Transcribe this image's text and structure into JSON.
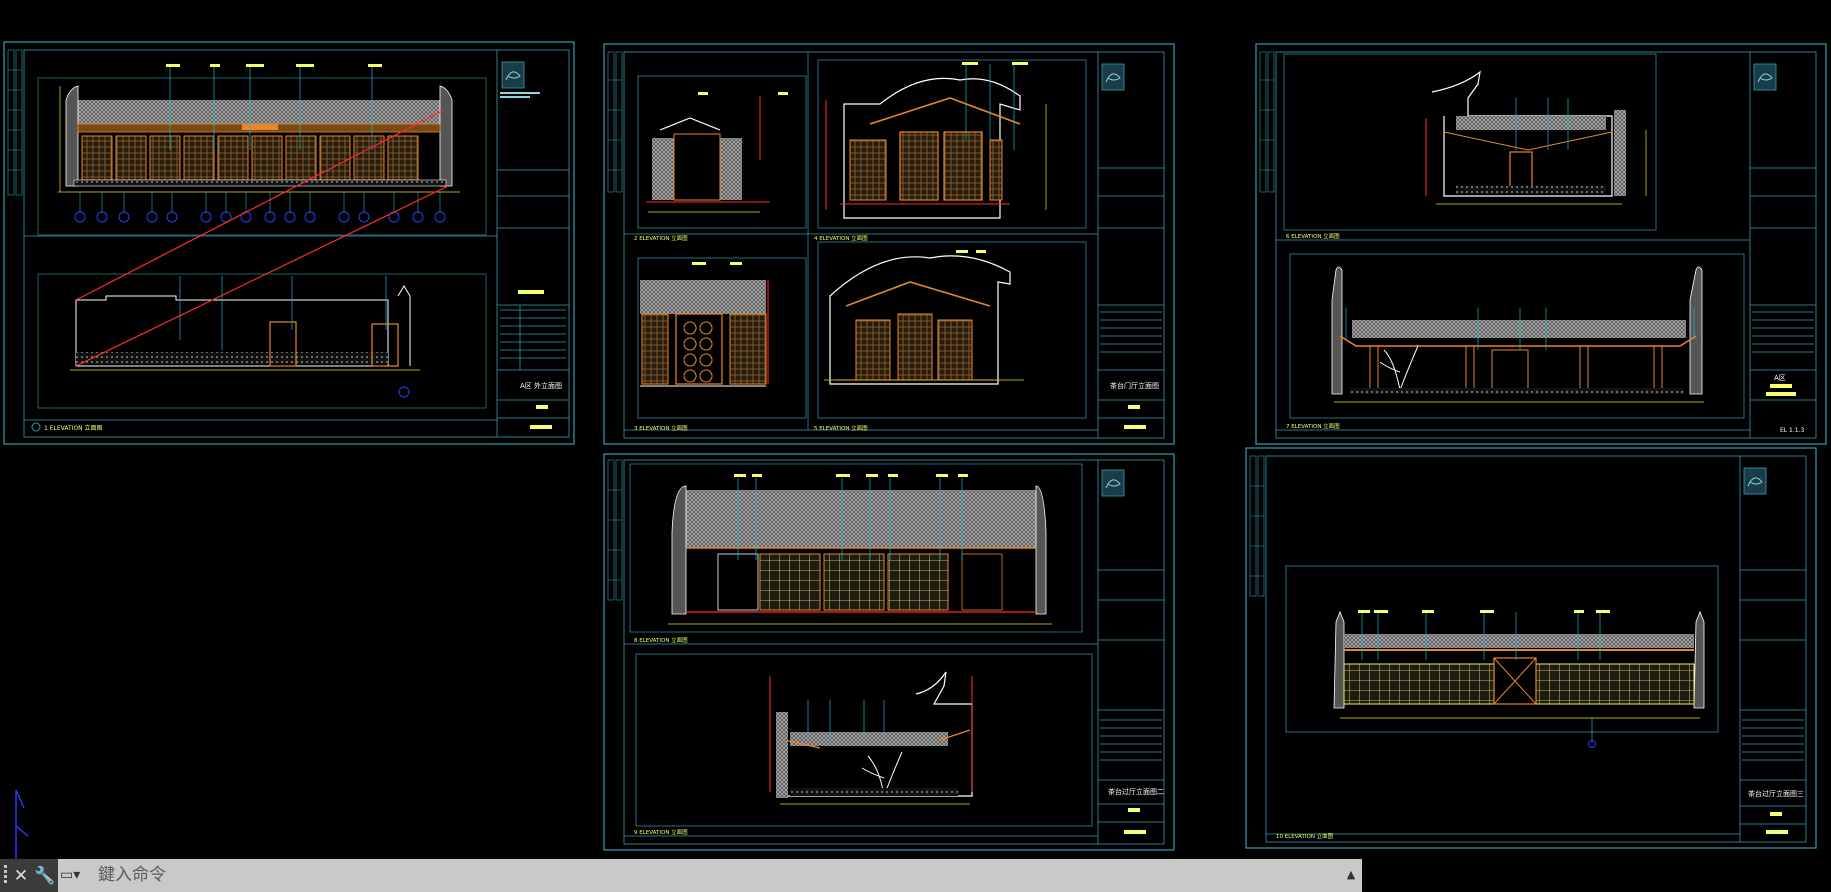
{
  "app": {
    "command_line": {
      "placeholder": "鍵入命令",
      "close_icon": "close-icon",
      "customize_icon": "wrench-icon",
      "history_icon": "command-history-icon",
      "expand_icon": "expand-up-icon"
    }
  },
  "colors": {
    "background": "#000000",
    "frame": "#2f9fb0",
    "wall": "#ffffff",
    "wood": "#e8862a",
    "dimension": "#f2e400",
    "leader": "#1fb6c9",
    "section_line": "#ff2a2a",
    "tile": "#9a9a9a",
    "highlight": "#f5ff6a",
    "ucs": "#2a3cff"
  },
  "sheets": [
    {
      "id": "sheet-1",
      "title_block_name": "A区 外立面图",
      "view_tags": [
        "1 ELEVATION 立面图"
      ],
      "grid_markers": [
        "A-1",
        "A-2",
        "A-3",
        "A-4",
        "A-5",
        "A-6",
        "A-7",
        "A-8",
        "A-9",
        "A-10",
        "A-11",
        "A-12",
        "A-13",
        "A-14"
      ]
    },
    {
      "id": "sheet-2",
      "title_block_name": "茶台门厅立面图",
      "view_tags": [
        "2 ELEVATION 立面图",
        "3 ELEVATION 立面图",
        "4 ELEVATION 立面图",
        "5 ELEVATION 立面图"
      ]
    },
    {
      "id": "sheet-3",
      "title_block_name": "A区",
      "view_tags": [
        "6 ELEVATION 立面图",
        "7 ELEVATION 立面图"
      ],
      "sheet_no": "EL 1.1.3"
    },
    {
      "id": "sheet-4",
      "title_block_name": "茶台过厅立面图二",
      "view_tags": [
        "8 ELEVATION 立面图",
        "9 ELEVATION 立面图"
      ]
    },
    {
      "id": "sheet-5",
      "title_block_name": "茶台过厅立面图三",
      "view_tags": [
        "10 ELEVATION 立面图"
      ]
    }
  ]
}
